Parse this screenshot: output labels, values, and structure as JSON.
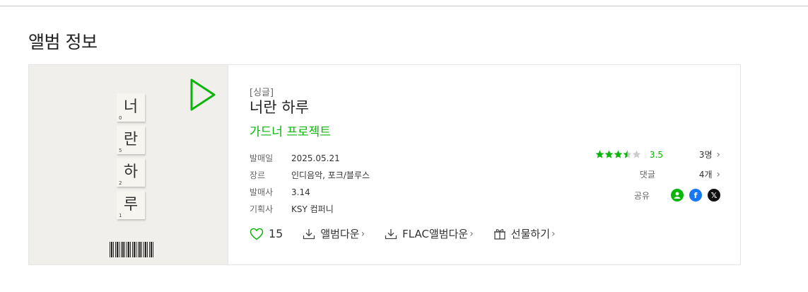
{
  "section": {
    "title": "앨범 정보"
  },
  "album": {
    "type": "[싱글]",
    "title": "너란 하루",
    "artist": "가드너 프로젝트",
    "cover": {
      "tiles": [
        {
          "char": "너",
          "num": "0"
        },
        {
          "char": "란",
          "num": "5"
        },
        {
          "char": "하",
          "num": "2"
        },
        {
          "char": "루",
          "num": "1"
        }
      ]
    }
  },
  "meta": [
    {
      "key": "발매일",
      "value": "2025.05.21"
    },
    {
      "key": "장르",
      "value": "인디음악, 포크/블루스"
    },
    {
      "key": "발매사",
      "value": "3.14"
    },
    {
      "key": "기획사",
      "value": "KSY 컴퍼니"
    }
  ],
  "rating": {
    "score": "3.5",
    "stars": 3.5,
    "participants": "3명"
  },
  "comments": {
    "label": "댓글",
    "count": "4개"
  },
  "share": {
    "label": "공유",
    "icons": [
      "profile-icon",
      "facebook-icon",
      "x-icon"
    ]
  },
  "actions": {
    "like_count": "15",
    "download": "앨범다운",
    "flac": "FLAC앨범다운",
    "gift": "선물하기"
  },
  "colors": {
    "accent": "#0cb50c",
    "facebook": "#1877f2",
    "x": "#111111",
    "star_empty": "#cccccc"
  }
}
